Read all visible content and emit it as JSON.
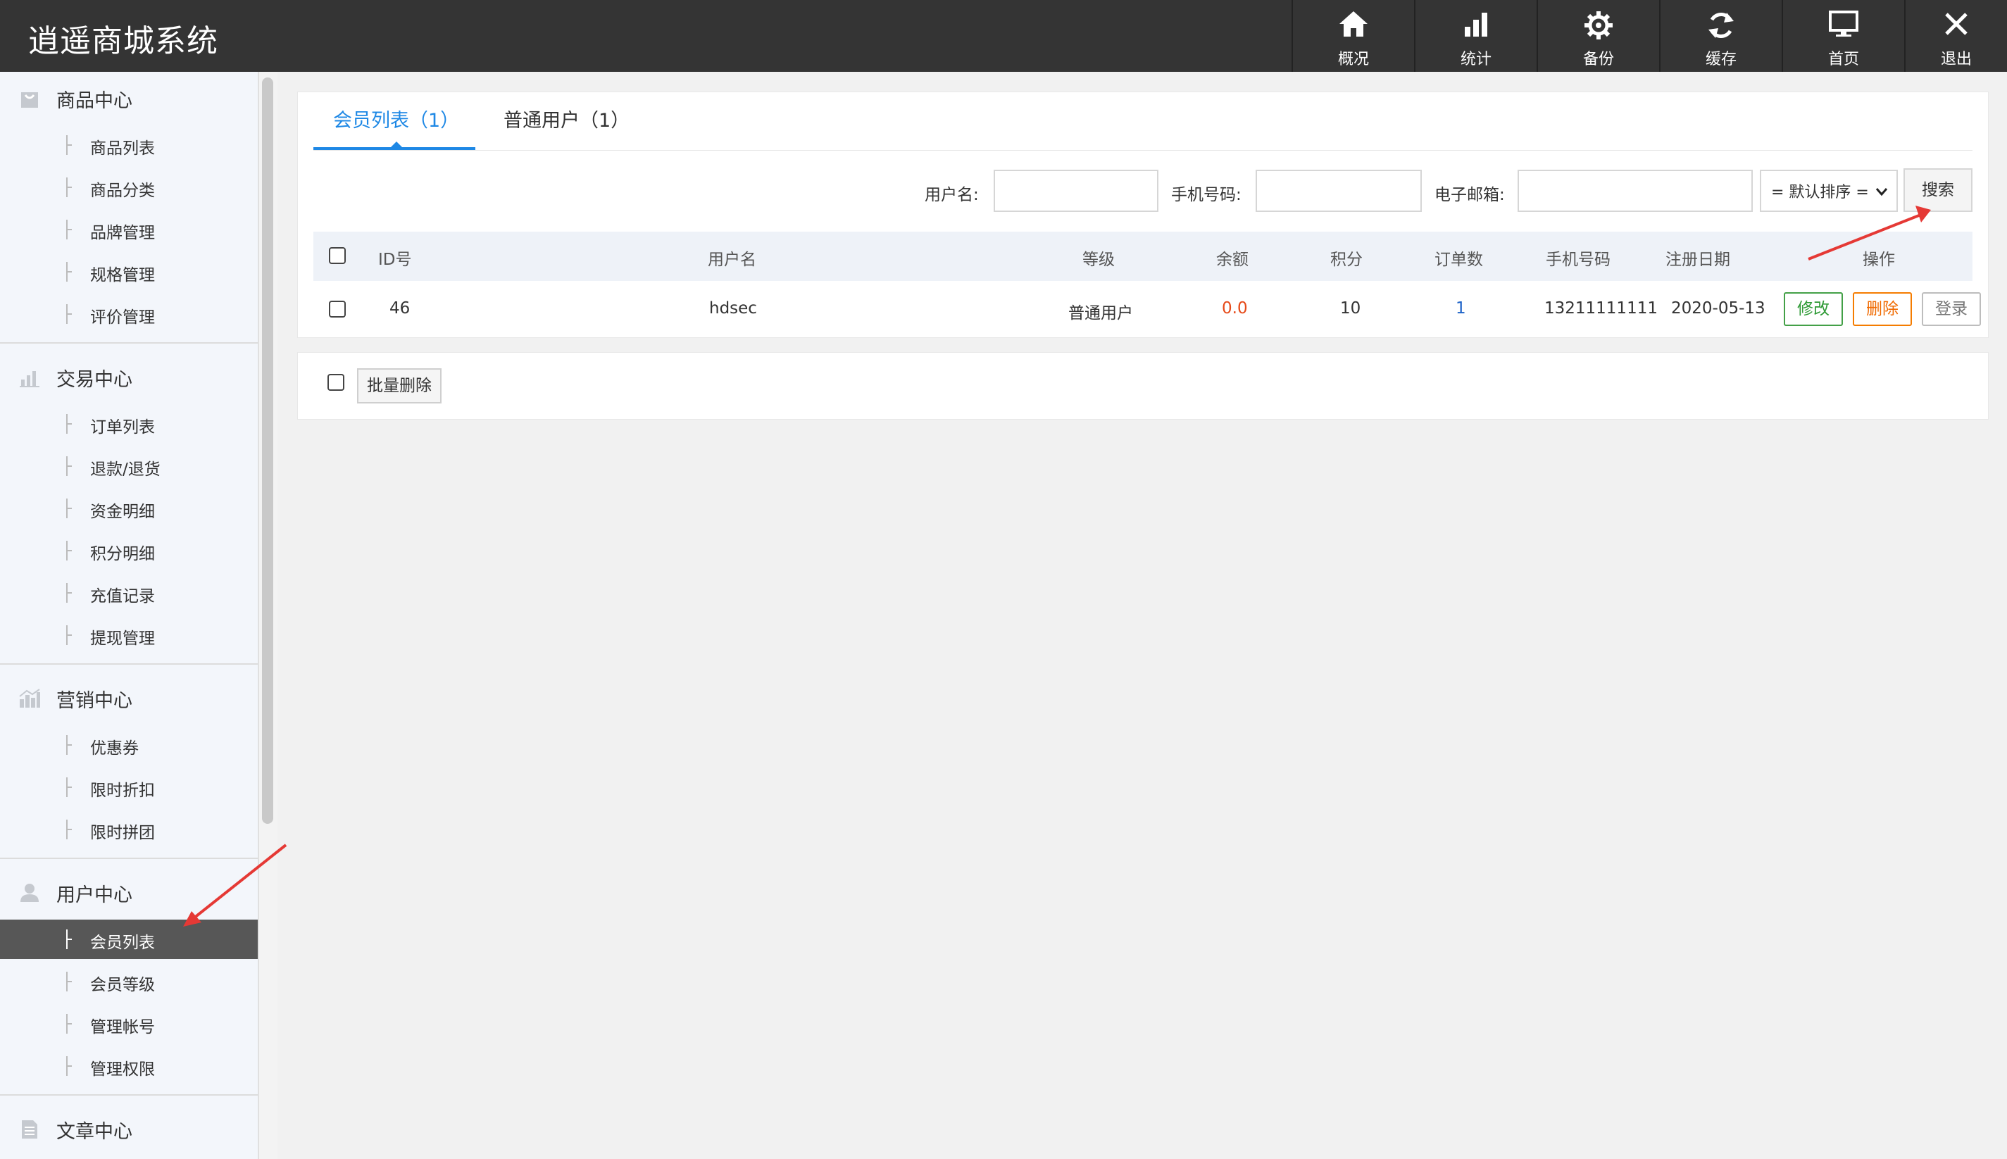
{
  "header": {
    "logo": "逍遥商城系统",
    "nav": [
      {
        "label": "概况",
        "icon": "home-icon"
      },
      {
        "label": "统计",
        "icon": "bar-chart-icon"
      },
      {
        "label": "备份",
        "icon": "gear-icon"
      },
      {
        "label": "缓存",
        "icon": "refresh-icon"
      },
      {
        "label": "首页",
        "icon": "monitor-icon"
      },
      {
        "label": "退出",
        "icon": "close-icon"
      }
    ]
  },
  "sidebar": {
    "groups": [
      {
        "title": "商品中心",
        "icon": "bag-icon",
        "items": [
          "商品列表",
          "商品分类",
          "品牌管理",
          "规格管理",
          "评价管理"
        ]
      },
      {
        "title": "交易中心",
        "icon": "bar-chart-icon",
        "items": [
          "订单列表",
          "退款/退货",
          "资金明细",
          "积分明细",
          "充值记录",
          "提现管理"
        ]
      },
      {
        "title": "营销中心",
        "icon": "marketing-chart-icon",
        "items": [
          "优惠券",
          "限时折扣",
          "限时拼团"
        ]
      },
      {
        "title": "用户中心",
        "icon": "user-icon",
        "items": [
          "会员列表",
          "会员等级",
          "管理帐号",
          "管理权限"
        ],
        "active_item": "会员列表"
      },
      {
        "title": "文章中心",
        "icon": "document-icon",
        "items": []
      }
    ]
  },
  "tabs": [
    {
      "label": "会员列表（1）",
      "active": true
    },
    {
      "label": "普通用户（1）",
      "active": false
    }
  ],
  "search": {
    "username_label": "用户名:",
    "phone_label": "手机号码:",
    "email_label": "电子邮箱:",
    "username_value": "",
    "phone_value": "",
    "email_value": "",
    "sort_selected": "= 默认排序 =",
    "search_button": "搜索"
  },
  "table": {
    "columns": [
      "ID号",
      "用户名",
      "等级",
      "余额",
      "积分",
      "订单数",
      "手机号码",
      "注册日期",
      "操作"
    ],
    "rows": [
      {
        "id": "46",
        "username": "hdsec",
        "level": "普通用户",
        "balance": "0.0",
        "points": "10",
        "orders": "1",
        "phone": "13211111111",
        "reg_date": "2020-05-13"
      }
    ],
    "actions": {
      "edit": "修改",
      "delete": "删除",
      "login": "登录"
    }
  },
  "footer": {
    "batch_delete": "批量删除"
  },
  "colors": {
    "header_bg": "#343434",
    "accent": "#1e88e5",
    "balance": "#e64a19",
    "edit": "#43a047",
    "delete": "#f57c00",
    "annotation_arrow": "#e53935"
  }
}
